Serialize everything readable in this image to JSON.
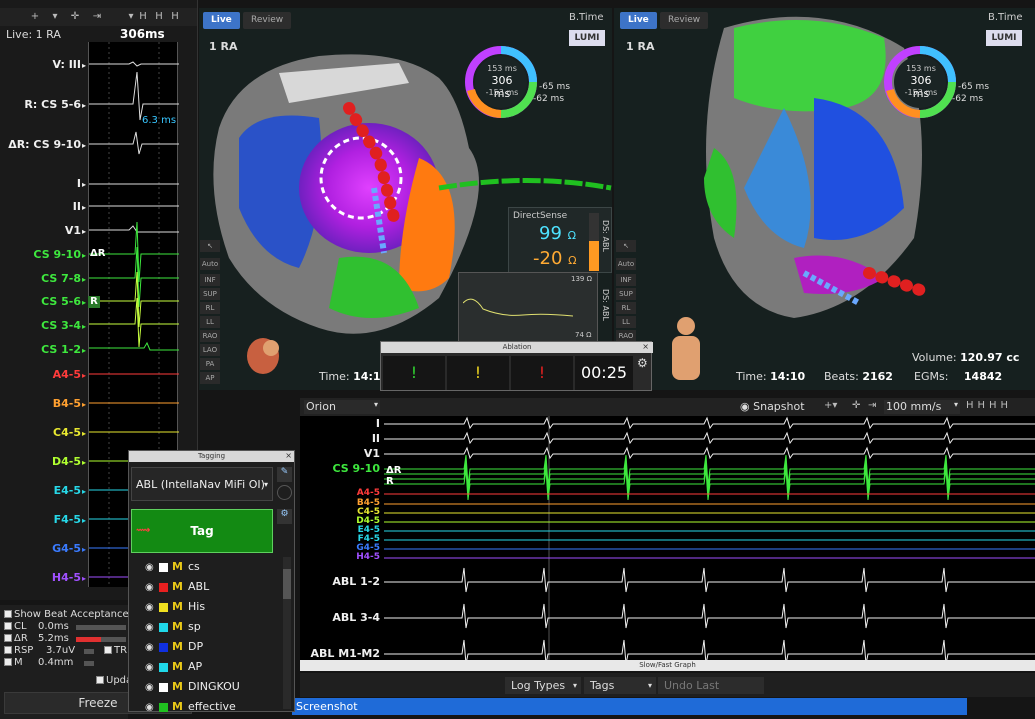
{
  "left_panel": {
    "live": "Live: 1 RA",
    "cycle": "306ms",
    "ms_annotation": "6.3 ms",
    "delta_marker": "ΔR",
    "r_marker": "R",
    "leads": [
      {
        "name": "V: III",
        "color": "white"
      },
      {
        "name": "R: CS 5-6",
        "color": "white"
      },
      {
        "name": "ΔR: CS 9-10",
        "color": "white"
      },
      {
        "name": "I",
        "color": "white"
      },
      {
        "name": "II",
        "color": "white"
      },
      {
        "name": "V1",
        "color": "white"
      },
      {
        "name": "CS 9-10",
        "color": "green"
      },
      {
        "name": "CS 7-8",
        "color": "green"
      },
      {
        "name": "CS 5-6",
        "color": "green"
      },
      {
        "name": "CS 3-4",
        "color": "green"
      },
      {
        "name": "CS 1-2",
        "color": "green"
      },
      {
        "name": "A4-5",
        "color": "red"
      },
      {
        "name": "B4-5",
        "color": "orange"
      },
      {
        "name": "C4-5",
        "color": "yellow"
      },
      {
        "name": "D4-5",
        "color": "ygreen"
      },
      {
        "name": "E4-5",
        "color": "cyan"
      },
      {
        "name": "F4-5",
        "color": "cyan"
      },
      {
        "name": "G4-5",
        "color": "blue"
      },
      {
        "name": "H4-5",
        "color": "purple"
      }
    ]
  },
  "beat": {
    "show_label": "Show Beat Acceptance",
    "rows": [
      {
        "label": "CL",
        "value": "0.0ms"
      },
      {
        "label": "ΔR",
        "value": "5.2ms"
      },
      {
        "label": "RSP",
        "value": "3.7uV"
      },
      {
        "label": "M",
        "value": "0.4mm"
      }
    ],
    "tr_label": "TR",
    "update_label": "Upda",
    "freeze_label": "Freeze"
  },
  "map_left": {
    "tab_live": "Live",
    "tab_review": "Review",
    "title": "1 RA",
    "btime": "B.Time",
    "lumi": "LUMI",
    "ring": {
      "top": "153 ms",
      "mid": "306 ms",
      "bot": "-153 ms",
      "r1": "-65 ms",
      "r2": "-62 ms"
    },
    "time_label": "Time:",
    "time_value": "14:1"
  },
  "map_right": {
    "tab_live": "Live",
    "tab_review": "Review",
    "title": "1 RA",
    "btime": "B.Time",
    "lumi": "LUMI",
    "ring": {
      "top": "153 ms",
      "mid": "306 ms",
      "bot": "-153 ms",
      "r1": "-65 ms",
      "r2": "-62 ms"
    },
    "time_label": "Time:",
    "time_value": "14:10",
    "beats_label": "Beats:",
    "beats_value": "2162",
    "volume_label": "Volume:",
    "volume_value": "120.97 cc",
    "egms_label": "EGMs:",
    "egms_value": "14842"
  },
  "side_buttons": [
    "Auto",
    "INF",
    "SUP",
    "RL",
    "LL",
    "RAO",
    "LAO",
    "PA",
    "AP"
  ],
  "direct_sense": {
    "title": "DirectSense",
    "value1": "99",
    "value1_unit": "Ω",
    "value2": "-20",
    "value2_unit": "Ω",
    "side_label": "DS: ABL",
    "level": 0.52
  },
  "impedance": {
    "max": "139 Ω",
    "min": "74 Ω",
    "side_label": "DS: ABL"
  },
  "ablation": {
    "title": "Ablation",
    "timer": "00:25",
    "marks": [
      "!",
      "!",
      "!"
    ]
  },
  "ecg_main": {
    "toolbar": {
      "view": "Orion",
      "snapshot": "Snapshot",
      "speed": "100 mm/s"
    },
    "leads": [
      {
        "name": "I",
        "color": "white"
      },
      {
        "name": "II",
        "color": "white"
      },
      {
        "name": "V1",
        "color": "white"
      },
      {
        "name": "CS 9-10",
        "color": "green"
      },
      {
        "name": "A4-5",
        "color": "red"
      },
      {
        "name": "B4-5",
        "color": "orange"
      },
      {
        "name": "C4-5",
        "color": "yellow"
      },
      {
        "name": "D4-5",
        "color": "ygreen"
      },
      {
        "name": "E4-5",
        "color": "cyan"
      },
      {
        "name": "F4-5",
        "color": "cyan"
      },
      {
        "name": "G4-5",
        "color": "blue"
      },
      {
        "name": "H4-5",
        "color": "purple"
      },
      {
        "name": "ABL 1-2",
        "color": "white"
      },
      {
        "name": "ABL 3-4",
        "color": "white"
      },
      {
        "name": "ABL M1-M2",
        "color": "white"
      }
    ],
    "delta_marker": "ΔR",
    "r_marker": "R",
    "footer": "Slow/Fast Graph"
  },
  "bottom_bar": {
    "log_types": "Log Types",
    "tags": "Tags",
    "undo": "Undo Last Deletion"
  },
  "screenshot_bar": "Screenshot",
  "tagging": {
    "title": "Tagging",
    "close": "×",
    "catheter": "ABL (IntellaNav MiFi OI)",
    "tag_button": "Tag",
    "items": [
      {
        "label": "cs",
        "swatch": "#ffffff"
      },
      {
        "label": "ABL",
        "swatch": "#e82020"
      },
      {
        "label": "His",
        "swatch": "#f0e020"
      },
      {
        "label": "sp",
        "swatch": "#20d8e8"
      },
      {
        "label": "DP",
        "swatch": "#1030e0"
      },
      {
        "label": "AP",
        "swatch": "#20d8e8"
      },
      {
        "label": "DINGKOU",
        "swatch": "#ffffff"
      },
      {
        "label": "effective",
        "swatch": "#20c020"
      }
    ]
  }
}
